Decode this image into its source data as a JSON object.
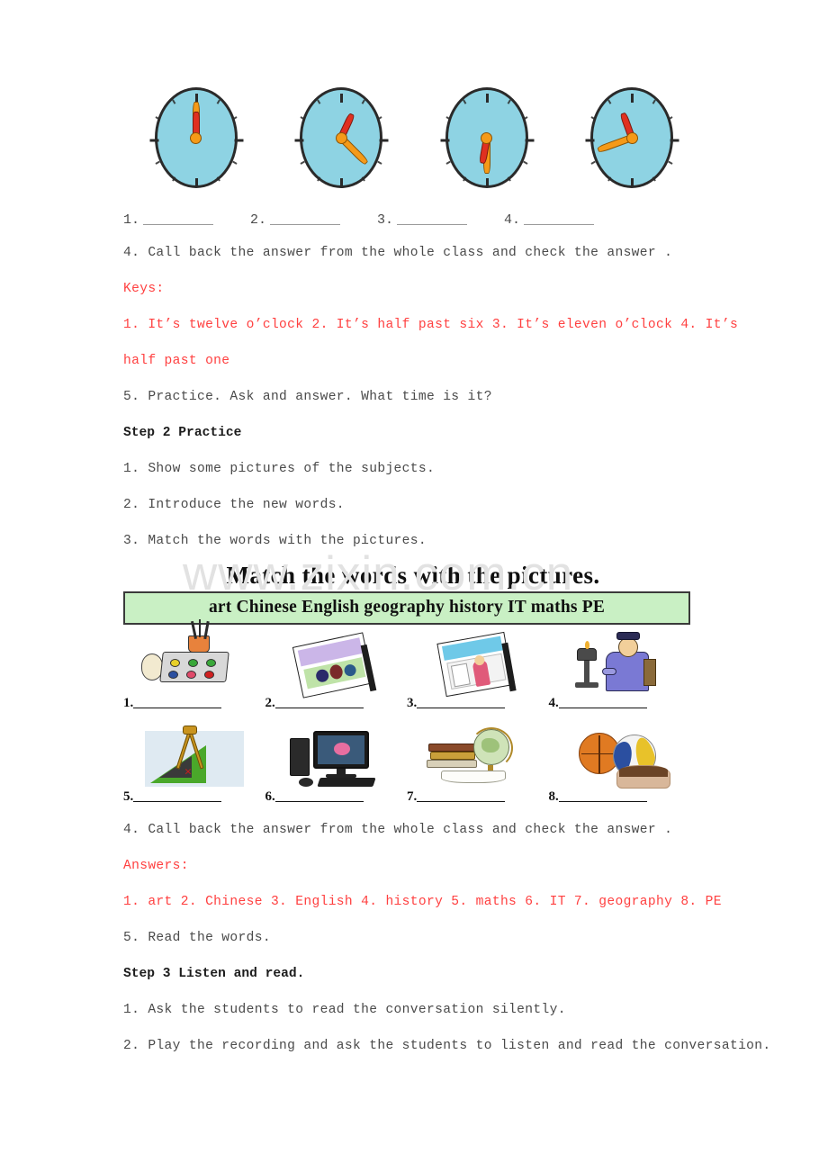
{
  "watermark": "www.zixin.com.cn",
  "clock_exercise": {
    "clocks": [
      {
        "id": "clock-1",
        "hour_deg": 0,
        "minute_deg": 0,
        "reading": "twelve o'clock"
      },
      {
        "id": "clock-2",
        "hour_deg": 25,
        "minute_deg": 135,
        "reading": "half past six"
      },
      {
        "id": "clock-3",
        "hour_deg": 190,
        "minute_deg": 180,
        "reading": "eleven o'clock"
      },
      {
        "id": "clock-4",
        "hour_deg": 340,
        "minute_deg": 250,
        "reading": "half past one"
      }
    ],
    "blanks": [
      "1.",
      "2.",
      "3.",
      "4."
    ]
  },
  "body": {
    "line_callback_1": "4. Call back the answer from the whole class and check the answer .",
    "keys_label": "Keys:",
    "keys_line_1": "1. It’s twelve o’clock 2. It’s half past six  3. It’s eleven o’clock 4. It’s",
    "keys_line_2": "half past one",
    "line_practice_5": "5. Practice. Ask and answer. What time is it?",
    "step2_heading": "Step 2 Practice",
    "step2_item_1": "1. Show some pictures of the subjects.",
    "step2_item_2": "2. Introduce the new words.",
    "step2_item_3": "3. Match the words with the pictures.",
    "line_callback_2": "4. Call back the answer from the whole class and check the answer .",
    "answers_label": "Answers:",
    "answers_line": "1. art  2. Chinese 3. English  4. history  5. maths 6. IT  7. geography 8. PE",
    "line_read_5": "5. Read the words.",
    "step3_heading": "Step 3 Listen and read.",
    "step3_item_1": "1. Ask the students to read the conversation silently.",
    "step3_item_2": "2. Play the recording and ask the students to listen and read the conversation."
  },
  "match_figure": {
    "title": "Match the words with the pictures.",
    "wordbank": "art Chinese English geography history IT maths PE",
    "wordbank_bg": "#c9f0c4",
    "wordbank_border": "#3a3a3a",
    "items": [
      {
        "number": "1.",
        "subject": "art",
        "icon": "paint-palette-icon"
      },
      {
        "number": "2.",
        "subject": "Chinese",
        "icon": "chinese-textbook-icon"
      },
      {
        "number": "3.",
        "subject": "English",
        "icon": "english-textbook-icon"
      },
      {
        "number": "4.",
        "subject": "history",
        "icon": "historical-scholar-icon"
      },
      {
        "number": "5.",
        "subject": "maths",
        "icon": "compass-triangle-icon"
      },
      {
        "number": "6.",
        "subject": "IT",
        "icon": "desktop-computer-icon"
      },
      {
        "number": "7.",
        "subject": "geography",
        "icon": "globe-books-icon"
      },
      {
        "number": "8.",
        "subject": "PE",
        "icon": "sports-balls-icon"
      }
    ]
  },
  "colors": {
    "answer_red": "#ff4040",
    "body_text": "#4a4a4a",
    "heading_text": "#1c1c1c",
    "clock_face": "#8ed3e3",
    "clock_outline": "#2a2a2a",
    "hour_hand": "#e03020",
    "minute_hand": "#f59a18"
  }
}
